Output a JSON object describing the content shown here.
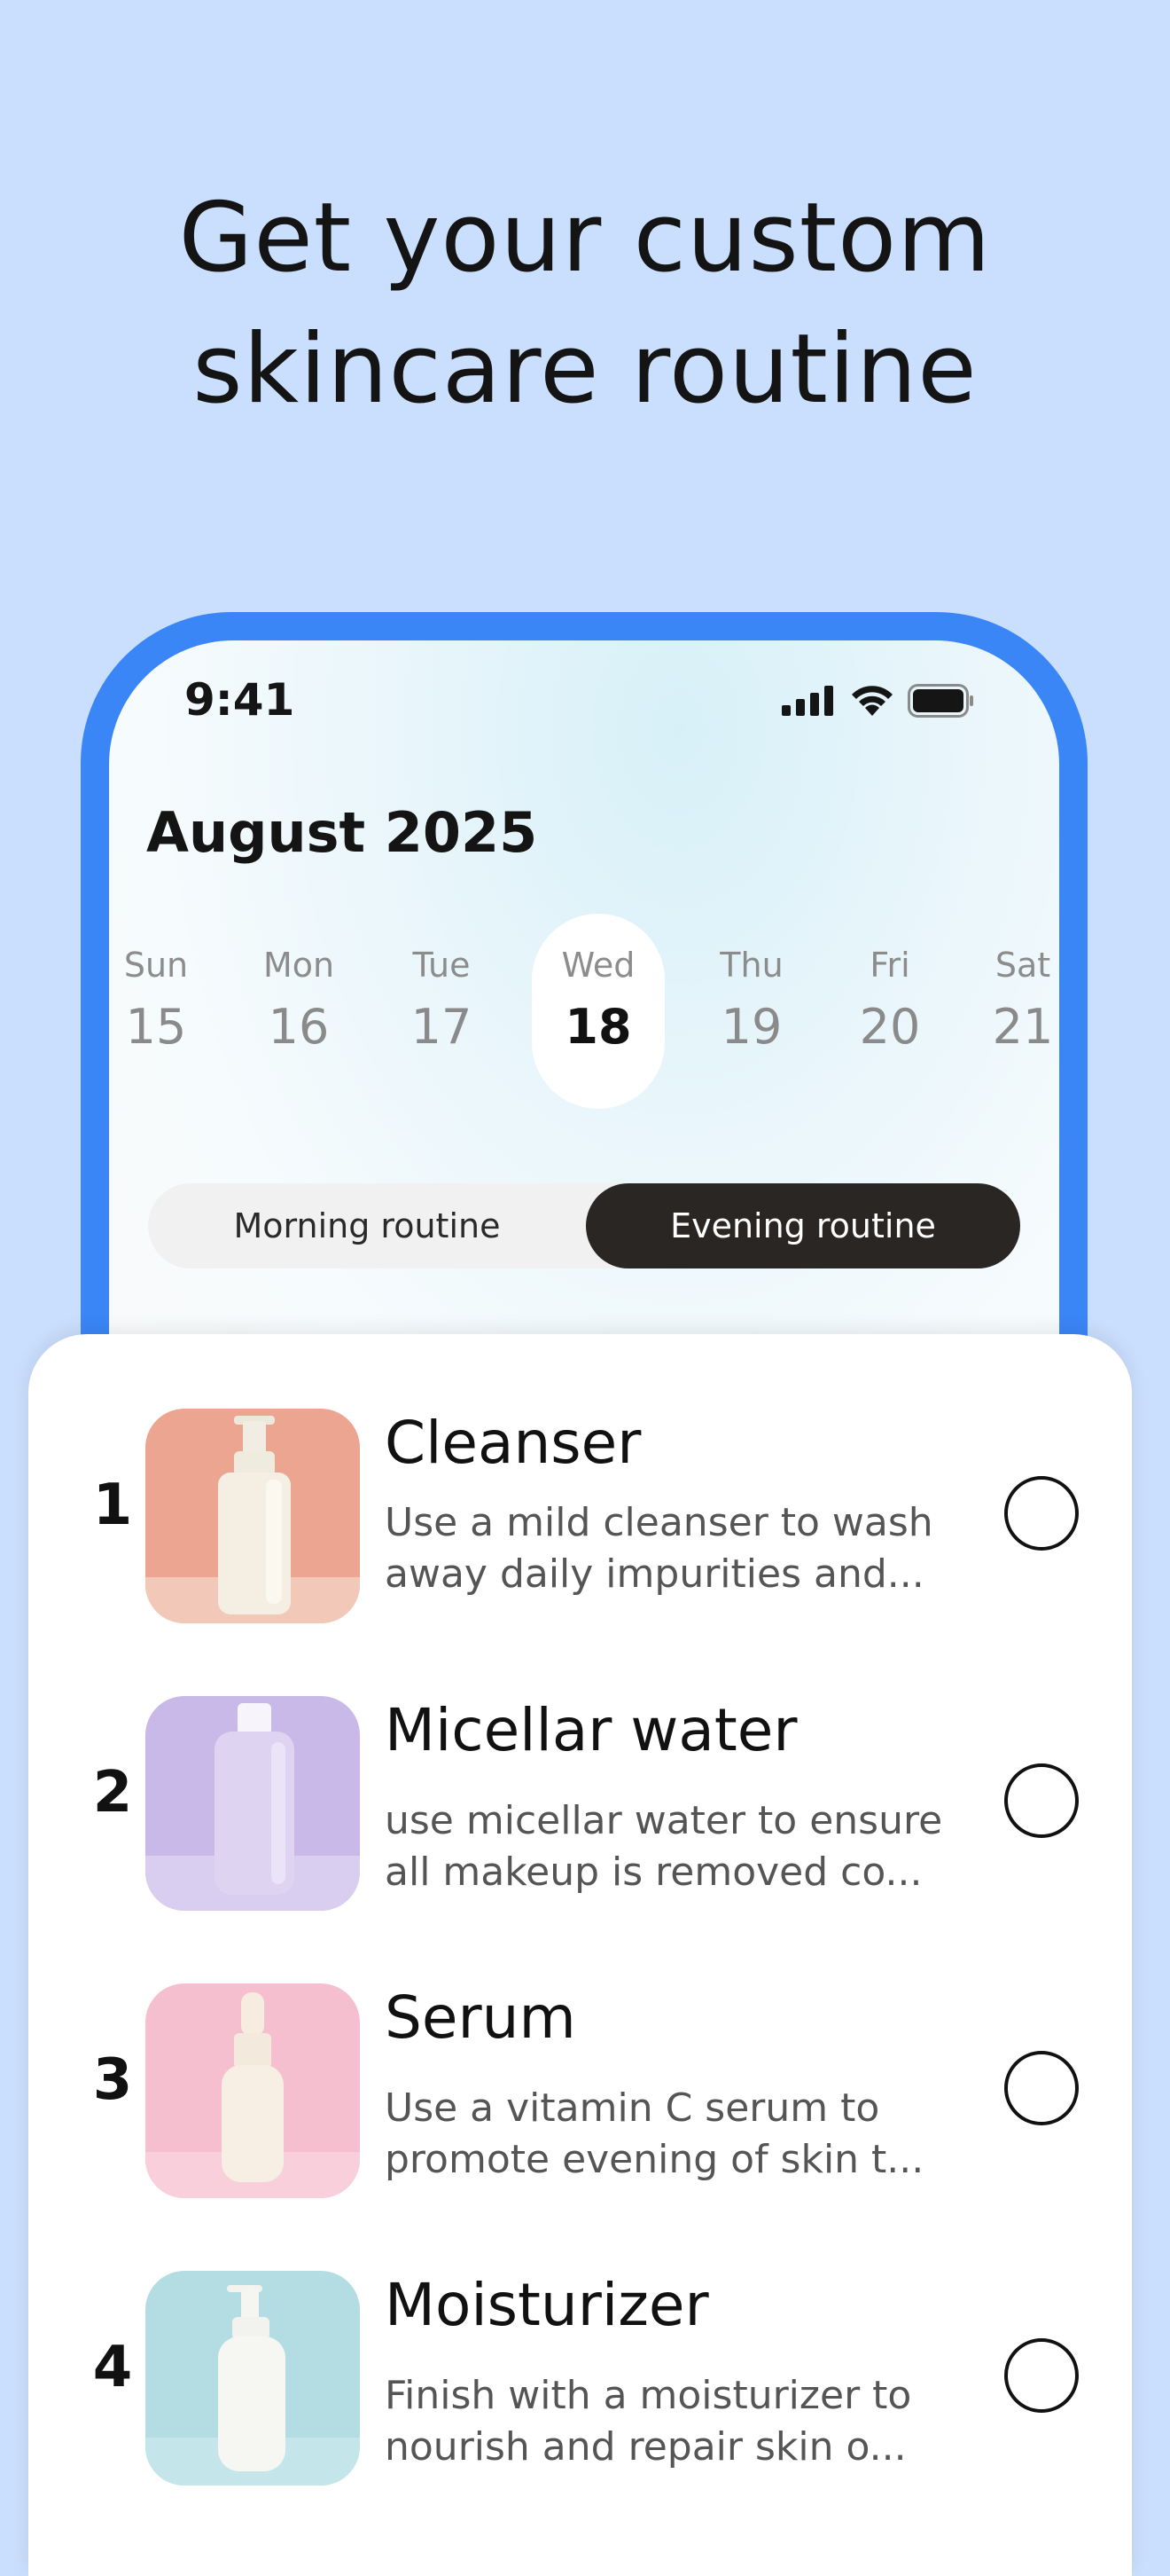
{
  "headline": {
    "line1": "Get your custom",
    "line2": "skincare routine"
  },
  "status": {
    "time": "9:41"
  },
  "calendar": {
    "month": "August 2025",
    "days": [
      {
        "name": "Sun",
        "num": "15"
      },
      {
        "name": "Mon",
        "num": "16"
      },
      {
        "name": "Tue",
        "num": "17"
      },
      {
        "name": "Wed",
        "num": "18"
      },
      {
        "name": "Thu",
        "num": "19"
      },
      {
        "name": "Fri",
        "num": "20"
      },
      {
        "name": "Sat",
        "num": "21"
      }
    ],
    "selected_day": "18"
  },
  "routine_toggle": {
    "morning": "Morning routine",
    "evening": "Evening routine",
    "selected": "Evening routine"
  },
  "steps": [
    {
      "num": "1",
      "title": "Cleanser",
      "line1": "Use a mild cleanser to wash",
      "line2": "away daily impurities and...",
      "checked": false
    },
    {
      "num": "2",
      "title": "Micellar water",
      "line1": "use micellar water to ensure",
      "line2": "all makeup is removed co...",
      "checked": false
    },
    {
      "num": "3",
      "title": "Serum",
      "line1": "Use a vitamin C serum to",
      "line2": "promote evening of skin t...",
      "checked": false
    },
    {
      "num": "4",
      "title": "Moisturizer",
      "line1": "Finish with a moisturizer to",
      "line2": "nourish and repair skin o...",
      "checked": false
    }
  ],
  "icons": [
    "signal-icon",
    "wifi-icon",
    "battery-icon",
    "check-circle-icon"
  ],
  "colors": {
    "background": "#cadefd",
    "frame": "#3a86f7",
    "toggle_active": "#2a2624"
  }
}
